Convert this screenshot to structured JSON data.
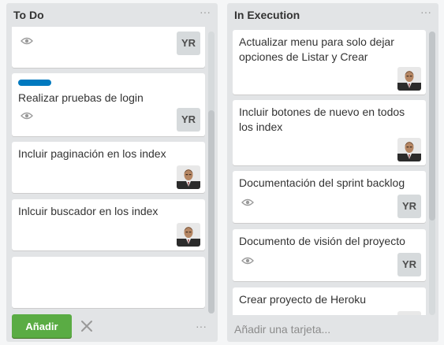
{
  "lists": [
    {
      "title": "To Do",
      "menu": "···",
      "cards": [
        {
          "text": "",
          "watch": true,
          "avatar_initials": "YR"
        },
        {
          "text": "Realizar pruebas de login",
          "label_color": "#0079bf",
          "watch": true,
          "avatar_initials": "YR"
        },
        {
          "text": "Incluir paginación en los index",
          "avatar": "photo"
        },
        {
          "text": "Inlcuir buscador en los index",
          "avatar": "photo"
        },
        {
          "text": "",
          "composer": true
        }
      ],
      "footer": {
        "add_label": "Añadir",
        "close": "close-icon",
        "more": "···"
      }
    },
    {
      "title": "In Execution",
      "menu": "···",
      "cards": [
        {
          "text": "Actualizar menu para solo dejar opciones de Listar y Crear",
          "avatar": "photo"
        },
        {
          "text": "Incluir botones de nuevo en todos los index",
          "avatar": "photo"
        },
        {
          "text": "Documentación del sprint backlog",
          "watch": true,
          "avatar_initials": "YR"
        },
        {
          "text": "Documento de visión del proyecto",
          "watch": true,
          "avatar_initials": "YR"
        },
        {
          "text": "Crear proyecto de Heroku",
          "avatar": "photo"
        }
      ],
      "footer": {
        "add_card_text": "Añadir una tarjeta..."
      }
    }
  ],
  "colors": {
    "board_bg": "#f5f6f7",
    "list_bg": "#e2e4e6",
    "label_blue": "#0079bf",
    "add_green": "#5aac44"
  }
}
